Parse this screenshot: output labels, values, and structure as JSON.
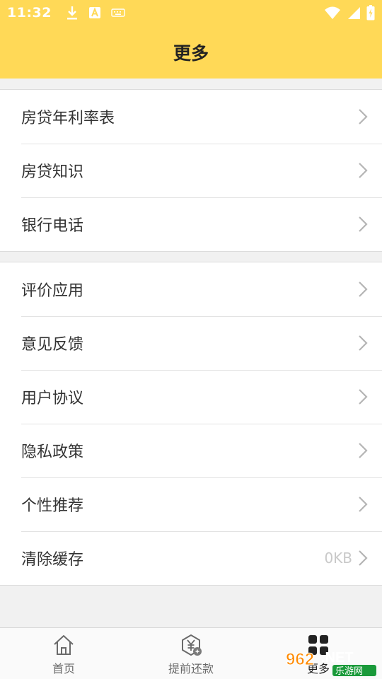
{
  "status_bar": {
    "time": "11:32",
    "icons": [
      "download-icon",
      "a-box-icon",
      "keyboard-icon",
      "wifi-icon",
      "cell-signal-icon",
      "battery-icon"
    ]
  },
  "header": {
    "title": "更多"
  },
  "groups": [
    {
      "items": [
        {
          "label": "房贷年利率表"
        },
        {
          "label": "房贷知识"
        },
        {
          "label": "银行电话"
        }
      ]
    },
    {
      "items": [
        {
          "label": "评价应用"
        },
        {
          "label": "意见反馈"
        },
        {
          "label": "用户协议"
        },
        {
          "label": "隐私政策"
        },
        {
          "label": "个性推荐"
        },
        {
          "label": "清除缓存",
          "value": "0KB"
        }
      ]
    }
  ],
  "tabs": [
    {
      "label": "首页",
      "icon": "home-icon"
    },
    {
      "label": "提前还款",
      "icon": "repay-icon"
    },
    {
      "label": "更多",
      "icon": "more-icon"
    }
  ],
  "watermark": {
    "text": "962.NET",
    "sub": "乐游网"
  },
  "colors": {
    "accent": "#ffd957",
    "chevron": "#b5b5b5",
    "tab_active": "#222222"
  }
}
